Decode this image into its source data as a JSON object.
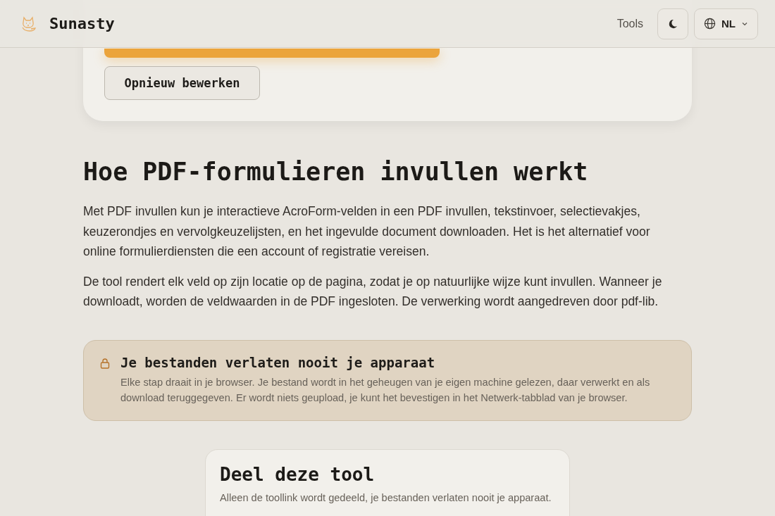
{
  "header": {
    "brand": "Sunasty",
    "nav": [
      "Tools"
    ],
    "language": "NL"
  },
  "result_card": {
    "edit_button": "Opnieuw bewerken"
  },
  "article": {
    "title": "Hoe PDF-formulieren invullen werkt",
    "paragraphs": [
      "Met PDF invullen kun je interactieve AcroForm-velden in een PDF invullen, tekstinvoer, selectievakjes, keuzerondjes en vervolgkeuzelijsten, en het ingevulde document downloaden. Het is het alternatief voor online formulierdiensten die een account of registratie vereisen.",
      "De tool rendert elk veld op zijn locatie op de pagina, zodat je op natuurlijke wijze kunt invullen. Wanneer je downloadt, worden de veldwaarden in de PDF ingesloten. De verwerking wordt aangedreven door pdf-lib."
    ]
  },
  "privacy_notice": {
    "title": "Je bestanden verlaten nooit je apparaat",
    "text": "Elke stap draait in je browser. Je bestand wordt in het geheugen van je eigen machine gelezen, daar verwerkt en als download teruggegeven. Er wordt niets geupload, je kunt het bevestigen in het Netwerk-tabblad van je browser."
  },
  "share_card": {
    "title": "Deel deze tool",
    "text": "Alleen de toollink wordt gedeeld, je bestanden verlaten nooit je apparaat."
  }
}
